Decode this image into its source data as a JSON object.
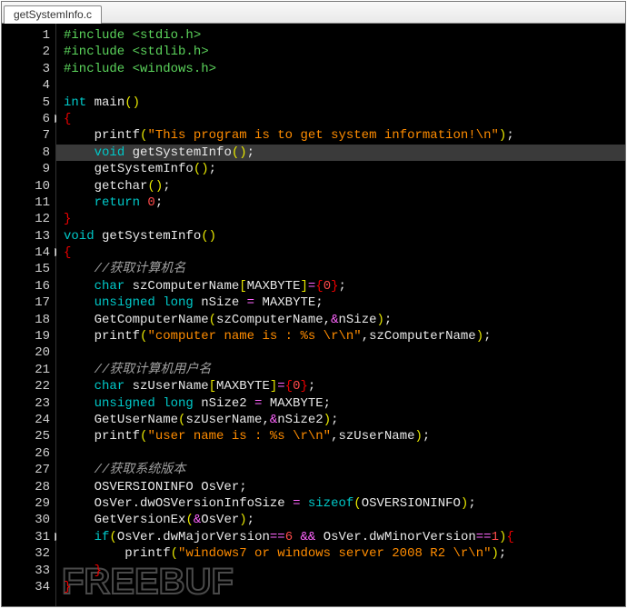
{
  "tab": {
    "filename": "getSystemInfo.c"
  },
  "watermark": {
    "text": "FREEBUF"
  },
  "lines": [
    {
      "n": 1,
      "tokens": [
        [
          "pre",
          "#include <stdio.h>"
        ]
      ]
    },
    {
      "n": 2,
      "tokens": [
        [
          "pre",
          "#include <stdlib.h>"
        ]
      ]
    },
    {
      "n": 3,
      "tokens": [
        [
          "pre",
          "#include <windows.h>"
        ]
      ]
    },
    {
      "n": 4,
      "tokens": []
    },
    {
      "n": 5,
      "tokens": [
        [
          "kw",
          "int "
        ],
        [
          "fn",
          "main"
        ],
        [
          "paren",
          "()"
        ]
      ]
    },
    {
      "n": 6,
      "fold": true,
      "tokens": [
        [
          "brace",
          "{"
        ]
      ]
    },
    {
      "n": 7,
      "indent": 1,
      "tokens": [
        [
          "fn",
          "printf"
        ],
        [
          "paren",
          "("
        ],
        [
          "str",
          "\"This program is to get system information!\\n\""
        ],
        [
          "paren",
          ")"
        ],
        [
          "op",
          ";"
        ]
      ]
    },
    {
      "n": 8,
      "highlight": true,
      "indent": 1,
      "tokens": [
        [
          "kw",
          "void "
        ],
        [
          "fn",
          "getSystemInfo"
        ],
        [
          "paren",
          "()"
        ],
        [
          "op",
          ";"
        ]
      ]
    },
    {
      "n": 9,
      "indent": 1,
      "tokens": [
        [
          "fn",
          "getSystemInfo"
        ],
        [
          "paren",
          "()"
        ],
        [
          "op",
          ";"
        ]
      ]
    },
    {
      "n": 10,
      "indent": 1,
      "tokens": [
        [
          "fn",
          "getchar"
        ],
        [
          "paren",
          "()"
        ],
        [
          "op",
          ";"
        ]
      ]
    },
    {
      "n": 11,
      "indent": 1,
      "tokens": [
        [
          "kw",
          "return "
        ],
        [
          "num",
          "0"
        ],
        [
          "op",
          ";"
        ]
      ]
    },
    {
      "n": 12,
      "tokens": [
        [
          "brace",
          "}"
        ]
      ]
    },
    {
      "n": 13,
      "tokens": [
        [
          "kw",
          "void "
        ],
        [
          "fn",
          "getSystemInfo"
        ],
        [
          "paren",
          "()"
        ]
      ]
    },
    {
      "n": 14,
      "fold": true,
      "tokens": [
        [
          "brace",
          "{"
        ]
      ]
    },
    {
      "n": 15,
      "indent": 1,
      "tokens": [
        [
          "cmt",
          "//获取计算机名"
        ]
      ]
    },
    {
      "n": 16,
      "indent": 1,
      "tokens": [
        [
          "kw",
          "char "
        ],
        [
          "id",
          "szComputerName"
        ],
        [
          "paren",
          "["
        ],
        [
          "id",
          "MAXBYTE"
        ],
        [
          "paren",
          "]"
        ],
        [
          "eq",
          "="
        ],
        [
          "brace",
          "{"
        ],
        [
          "num",
          "0"
        ],
        [
          "brace",
          "}"
        ],
        [
          "op",
          ";"
        ]
      ]
    },
    {
      "n": 17,
      "indent": 1,
      "tokens": [
        [
          "kw",
          "unsigned long "
        ],
        [
          "id",
          "nSize "
        ],
        [
          "eq",
          "="
        ],
        [
          "id",
          " MAXBYTE"
        ],
        [
          "op",
          ";"
        ]
      ]
    },
    {
      "n": 18,
      "indent": 1,
      "tokens": [
        [
          "fn",
          "GetComputerName"
        ],
        [
          "paren",
          "("
        ],
        [
          "id",
          "szComputerName"
        ],
        [
          "op",
          ","
        ],
        [
          "amp",
          "&"
        ],
        [
          "id",
          "nSize"
        ],
        [
          "paren",
          ")"
        ],
        [
          "op",
          ";"
        ]
      ]
    },
    {
      "n": 19,
      "indent": 1,
      "tokens": [
        [
          "fn",
          "printf"
        ],
        [
          "paren",
          "("
        ],
        [
          "str",
          "\"computer name is : %s \\r\\n\""
        ],
        [
          "op",
          ","
        ],
        [
          "id",
          "szComputerName"
        ],
        [
          "paren",
          ")"
        ],
        [
          "op",
          ";"
        ]
      ]
    },
    {
      "n": 20,
      "tokens": []
    },
    {
      "n": 21,
      "indent": 1,
      "tokens": [
        [
          "cmt",
          "//获取计算机用户名"
        ]
      ]
    },
    {
      "n": 22,
      "indent": 1,
      "tokens": [
        [
          "kw",
          "char "
        ],
        [
          "id",
          "szUserName"
        ],
        [
          "paren",
          "["
        ],
        [
          "id",
          "MAXBYTE"
        ],
        [
          "paren",
          "]"
        ],
        [
          "eq",
          "="
        ],
        [
          "brace",
          "{"
        ],
        [
          "num",
          "0"
        ],
        [
          "brace",
          "}"
        ],
        [
          "op",
          ";"
        ]
      ]
    },
    {
      "n": 23,
      "indent": 1,
      "tokens": [
        [
          "kw",
          "unsigned long "
        ],
        [
          "id",
          "nSize2 "
        ],
        [
          "eq",
          "="
        ],
        [
          "id",
          " MAXBYTE"
        ],
        [
          "op",
          ";"
        ]
      ]
    },
    {
      "n": 24,
      "indent": 1,
      "tokens": [
        [
          "fn",
          "GetUserName"
        ],
        [
          "paren",
          "("
        ],
        [
          "id",
          "szUserName"
        ],
        [
          "op",
          ","
        ],
        [
          "amp",
          "&"
        ],
        [
          "id",
          "nSize2"
        ],
        [
          "paren",
          ")"
        ],
        [
          "op",
          ";"
        ]
      ]
    },
    {
      "n": 25,
      "indent": 1,
      "tokens": [
        [
          "fn",
          "printf"
        ],
        [
          "paren",
          "("
        ],
        [
          "str",
          "\"user name is : %s \\r\\n\""
        ],
        [
          "op",
          ","
        ],
        [
          "id",
          "szUserName"
        ],
        [
          "paren",
          ")"
        ],
        [
          "op",
          ";"
        ]
      ]
    },
    {
      "n": 26,
      "tokens": []
    },
    {
      "n": 27,
      "indent": 1,
      "tokens": [
        [
          "cmt",
          "//获取系统版本"
        ]
      ]
    },
    {
      "n": 28,
      "indent": 1,
      "tokens": [
        [
          "id",
          "OSVERSIONINFO OsVer"
        ],
        [
          "op",
          ";"
        ]
      ]
    },
    {
      "n": 29,
      "indent": 1,
      "tokens": [
        [
          "id",
          "OsVer"
        ],
        [
          "op",
          "."
        ],
        [
          "id",
          "dwOSVersionInfoSize "
        ],
        [
          "eq",
          "="
        ],
        [
          "kw",
          " sizeof"
        ],
        [
          "paren",
          "("
        ],
        [
          "id",
          "OSVERSIONINFO"
        ],
        [
          "paren",
          ")"
        ],
        [
          "op",
          ";"
        ]
      ]
    },
    {
      "n": 30,
      "indent": 1,
      "tokens": [
        [
          "fn",
          "GetVersionEx"
        ],
        [
          "paren",
          "("
        ],
        [
          "amp",
          "&"
        ],
        [
          "id",
          "OsVer"
        ],
        [
          "paren",
          ")"
        ],
        [
          "op",
          ";"
        ]
      ]
    },
    {
      "n": 31,
      "fold": true,
      "indent": 1,
      "tokens": [
        [
          "kw",
          "if"
        ],
        [
          "paren",
          "("
        ],
        [
          "id",
          "OsVer"
        ],
        [
          "op",
          "."
        ],
        [
          "id",
          "dwMajorVersion"
        ],
        [
          "eq",
          "=="
        ],
        [
          "num",
          "6"
        ],
        [
          "id",
          " "
        ],
        [
          "eq",
          "&&"
        ],
        [
          "id",
          " OsVer"
        ],
        [
          "op",
          "."
        ],
        [
          "id",
          "dwMinorVersion"
        ],
        [
          "eq",
          "=="
        ],
        [
          "num",
          "1"
        ],
        [
          "paren",
          ")"
        ],
        [
          "brace",
          "{"
        ]
      ]
    },
    {
      "n": 32,
      "indent": 2,
      "tokens": [
        [
          "fn",
          "printf"
        ],
        [
          "paren",
          "("
        ],
        [
          "str",
          "\"windows7 or windows server 2008 R2 \\r\\n\""
        ],
        [
          "paren",
          ")"
        ],
        [
          "op",
          ";"
        ]
      ]
    },
    {
      "n": 33,
      "indent": 1,
      "tokens": [
        [
          "brace",
          "}"
        ]
      ]
    },
    {
      "n": 34,
      "tokens": [
        [
          "brace",
          "}"
        ]
      ]
    }
  ]
}
